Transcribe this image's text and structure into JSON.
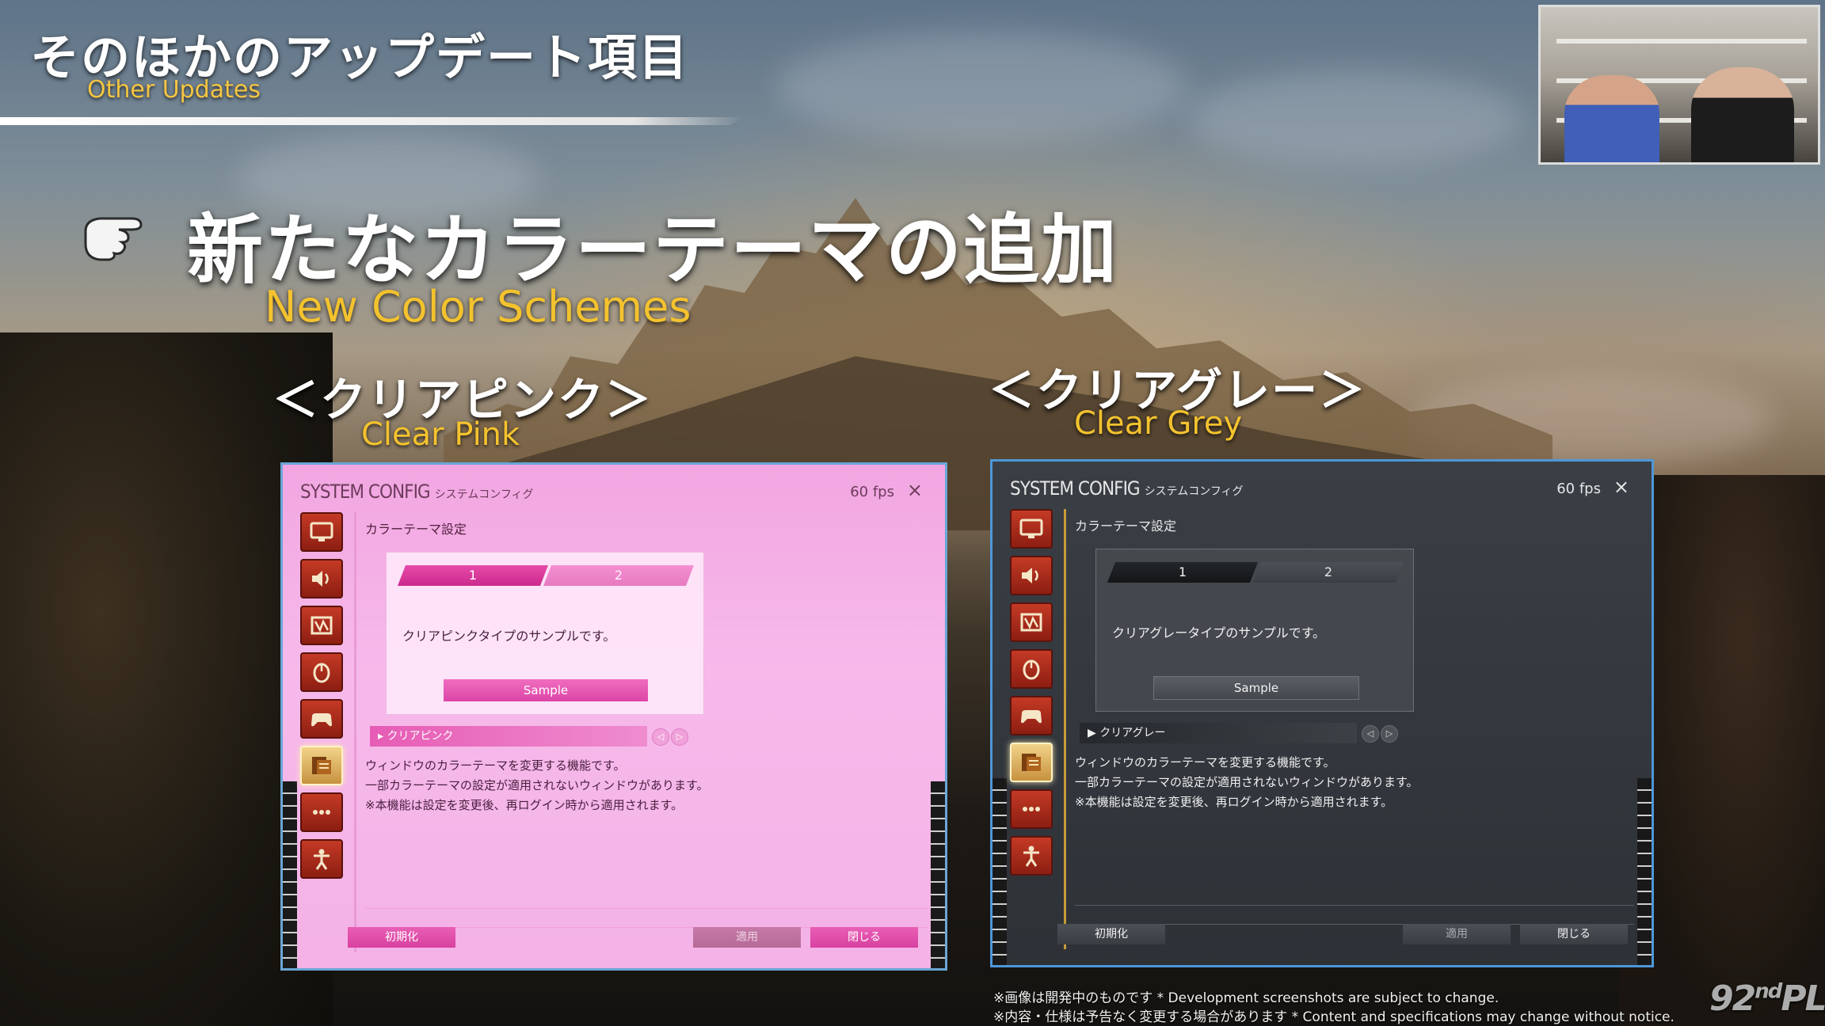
{
  "header": {
    "title": "そのほかのアップデート項目",
    "subtitle": "Other Updates"
  },
  "headline": {
    "title": "新たなカラーテーマの追加",
    "subtitle": "New Color Schemes"
  },
  "themes": [
    {
      "jp_label": "＜クリアピンク＞",
      "en_label": "Clear Pink",
      "window": {
        "title": "SYSTEM CONFIG",
        "title_jp": "システムコンフィグ",
        "fps": "60 fps",
        "close_glyph": "×",
        "section": "カラーテーマ設定",
        "tab1": "1",
        "tab2": "2",
        "sample_text": "クリアピンクタイプのサンプルです。",
        "sample_button": "Sample",
        "selected_theme": "▸ クリアピンク",
        "prev_glyph": "◁",
        "next_glyph": "▷",
        "desc_lines": [
          "ウィンドウのカラーテーマを変更する機能です。",
          "一部カラーテーマの設定が適用されないウィンドウがあります。",
          "※本機能は設定を変更後、再ログイン時から適用されます。"
        ],
        "btn_reset": "初期化",
        "btn_apply": "適用",
        "btn_close": "閉じる"
      }
    },
    {
      "jp_label": "＜クリアグレー＞",
      "en_label": "Clear Grey",
      "window": {
        "title": "SYSTEM CONFIG",
        "title_jp": "システムコンフィグ",
        "fps": "60 fps",
        "close_glyph": "×",
        "section": "カラーテーマ設定",
        "tab1": "1",
        "tab2": "2",
        "sample_text": "クリアグレータイプのサンプルです。",
        "sample_button": "Sample",
        "selected_theme": "▶ クリアグレー",
        "prev_glyph": "◁",
        "next_glyph": "▷",
        "desc_lines": [
          "ウィンドウのカラーテーマを変更する機能です。",
          "一部カラーテーマの設定が適用されないウィンドウがあります。",
          "※本機能は設定を変更後、再ログイン時から適用されます。"
        ],
        "btn_reset": "初期化",
        "btn_apply": "適用",
        "btn_close": "閉じる"
      }
    }
  ],
  "sidebar_icons": [
    "display-icon",
    "speaker-icon",
    "ui-icon",
    "mouse-icon",
    "gamepad-icon",
    "color-theme-icon",
    "more-icon",
    "character-icon"
  ],
  "footer": {
    "line1": "※画像は開発中のものです  * Development screenshots are subject to change.",
    "line2": "※内容・仕様は予告なく変更する場合があります  * Content and specifications may change without notice."
  },
  "logo": {
    "number": "92",
    "suffix": "nd",
    "letters": "PLL"
  },
  "colors": {
    "accent_gold": "#f3c22e",
    "pink_window": "#f4b2e6",
    "grey_window": "#33383e",
    "window_border": "#4e97d8"
  }
}
